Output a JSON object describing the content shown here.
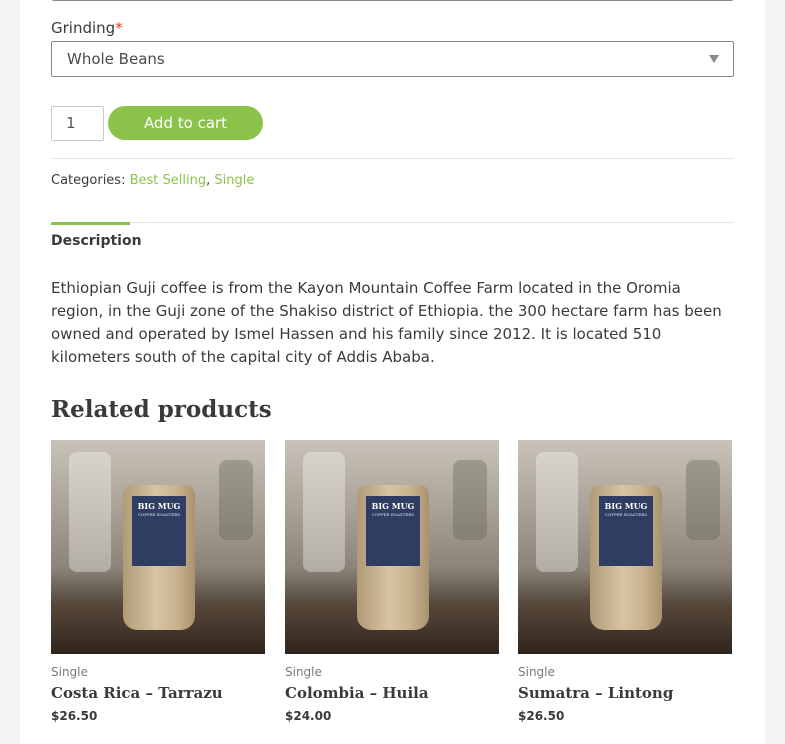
{
  "form": {
    "grinding_label": "Grinding",
    "required_mark": "*",
    "grinding_value": "Whole Beans",
    "quantity": "1",
    "add_to_cart": "Add to cart"
  },
  "meta": {
    "categories_label": "Categories:",
    "categories": [
      "Best Selling",
      "Single"
    ],
    "separator": ","
  },
  "tabs": {
    "description": "Description"
  },
  "description": "Ethiopian Guji coffee is from the Kayon Mountain Coffee Farm located in the Oromia region, in the Guji zone of the Shakiso district of Ethiopia. the 300 hectare farm has been owned and operated by Ismel Hassen and his family since 2012. It is located 510 kilometers south of the capital city of Addis Ababa.",
  "related": {
    "heading": "Related products",
    "brand": "BIG MUG",
    "brand_sub": "COFFEE ROASTERS",
    "products": [
      {
        "category": "Single",
        "name": "Costa Rica – Tarrazu",
        "price": "$26.50"
      },
      {
        "category": "Single",
        "name": "Colombia – Huila",
        "price": "$24.00"
      },
      {
        "category": "Single",
        "name": "Sumatra – Lintong",
        "price": "$26.50"
      }
    ]
  },
  "colors": {
    "accent": "#8bc34a",
    "required": "#e2401c",
    "text": "#3a3a3a"
  }
}
